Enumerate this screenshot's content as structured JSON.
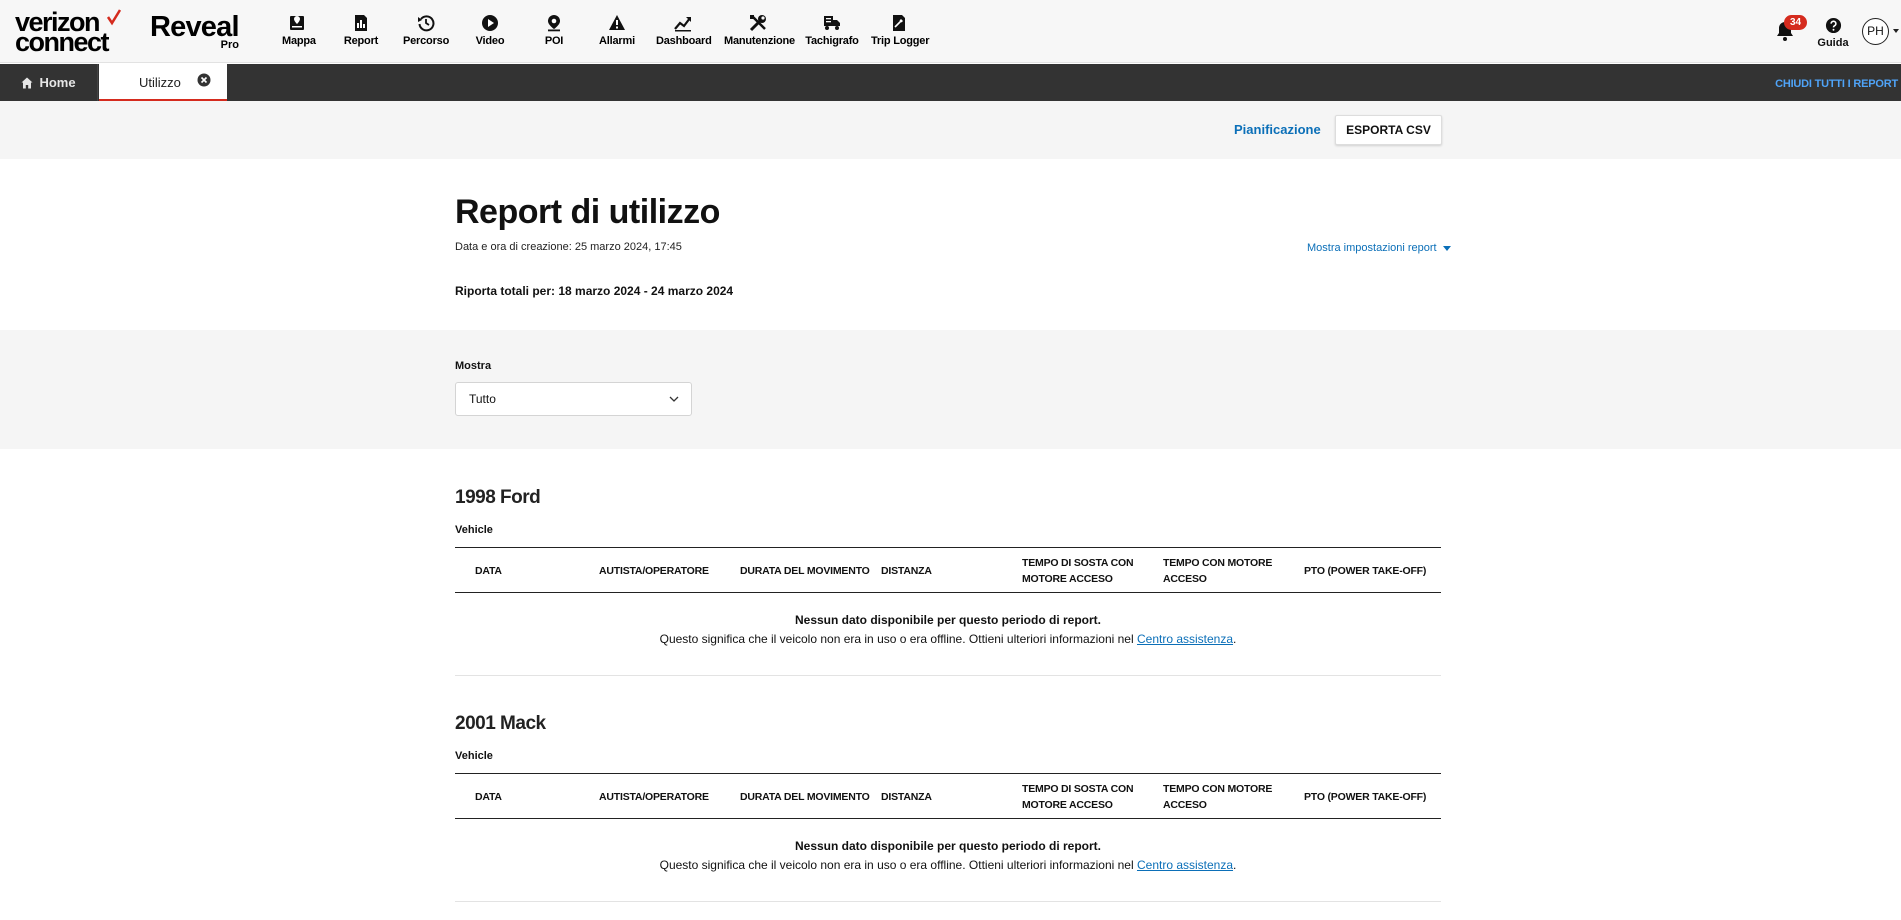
{
  "brand": {
    "logo_line1": "verizon",
    "logo_line2": "connect",
    "product": "Reveal",
    "tier": "Pro"
  },
  "nav": [
    {
      "label": "Mappa",
      "icon": "map-icon"
    },
    {
      "label": "Report",
      "icon": "report-icon"
    },
    {
      "label": "Percorso",
      "icon": "history-icon"
    },
    {
      "label": "Video",
      "icon": "video-play-icon"
    },
    {
      "label": "POI",
      "icon": "poi-pin-icon"
    },
    {
      "label": "Allarmi",
      "icon": "alert-icon"
    },
    {
      "label": "Dashboard",
      "icon": "dashboard-chart-icon"
    },
    {
      "label": "Manutenzione",
      "icon": "tools-icon"
    },
    {
      "label": "Tachigrafo",
      "icon": "tachograph-truck-icon"
    },
    {
      "label": "Trip Logger",
      "icon": "trip-logger-icon"
    }
  ],
  "notifications": {
    "count": "34"
  },
  "help": {
    "label": "Guida"
  },
  "user": {
    "initials": "PH"
  },
  "tabs": {
    "home": "Home",
    "active": "Utilizzo",
    "close_all": "CHIUDI TUTTI I REPORT"
  },
  "actions": {
    "schedule": "Pianificazione",
    "export": "ESPORTA CSV"
  },
  "report": {
    "title": "Report di utilizzo",
    "created": "Data e ora di creazione: 25 marzo 2024, 17:45",
    "show_settings": "Mostra impostazioni report",
    "totals": "Riporta totali per: 18 marzo 2024 - 24 marzo 2024"
  },
  "filter": {
    "label": "Mostra",
    "value": "Tutto"
  },
  "columns": [
    "DATA",
    "AUTISTA/OPERATORE",
    "DURATA DEL MOVIMENTO",
    "DISTANZA",
    "TEMPO DI SOSTA CON MOTORE ACCESO",
    "TEMPO CON MOTORE ACCESO",
    "PTO (POWER TAKE-OFF)"
  ],
  "empty": {
    "title": "Nessun dato disponibile per questo periodo di report.",
    "message": "Questo significa che il veicolo non era in uso o era offline. Ottieni ulteriori informazioni nel ",
    "link": "Centro assistenza",
    "end": "."
  },
  "vehicles": [
    {
      "name": "1998 Ford",
      "type": "Vehicle"
    },
    {
      "name": "2001 Mack",
      "type": "Vehicle"
    }
  ],
  "colors": {
    "accent_red": "#d52b1e",
    "link_blue": "#0b6fb8",
    "tabbar": "#333333"
  }
}
